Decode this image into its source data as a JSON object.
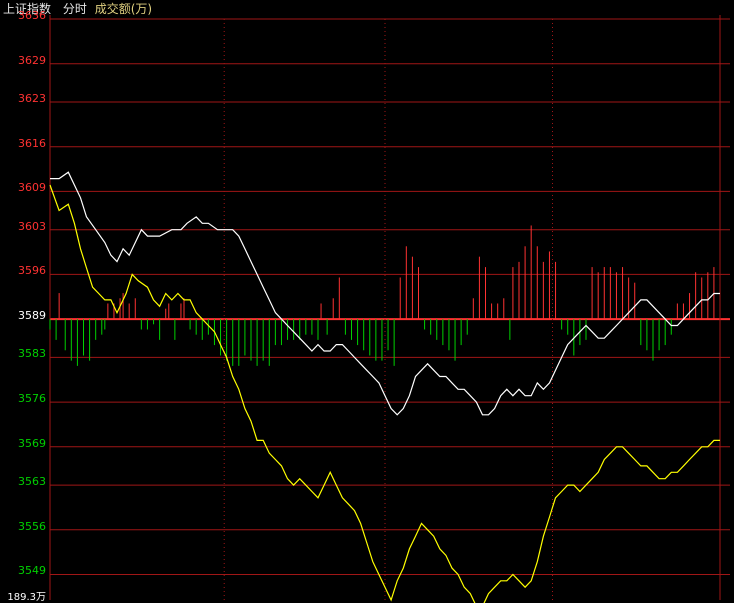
{
  "header": {
    "index_name": "上证指数",
    "mode": "分时",
    "volume_unit": "成交额(万)"
  },
  "colors": {
    "up": "#ff3232",
    "down": "#00d000",
    "baseline": "#ff3232",
    "grid": "#a01616",
    "price_line": "#ffffff",
    "avg_line": "#ffff00"
  },
  "chart_data": {
    "type": "line",
    "title": "",
    "baseline": 3589,
    "ylim": [
      3545,
      3636
    ],
    "y_ticks": [
      "3636",
      "3629",
      "3623",
      "3616",
      "3609",
      "3603",
      "3596",
      "3589",
      "3583",
      "3576",
      "3569",
      "3563",
      "3556",
      "3549"
    ],
    "volume_axis_label": "189.3万",
    "series": [
      {
        "kind": "price",
        "points": [
          [
            0,
            3611
          ],
          [
            3,
            3611
          ],
          [
            6,
            3612
          ],
          [
            8,
            3610
          ],
          [
            10,
            3608
          ],
          [
            12,
            3605
          ],
          [
            15,
            3603
          ],
          [
            18,
            3601
          ],
          [
            20,
            3599
          ],
          [
            22,
            3598
          ],
          [
            24,
            3600
          ],
          [
            26,
            3599
          ],
          [
            28,
            3601
          ],
          [
            30,
            3603
          ],
          [
            32,
            3602
          ],
          [
            36,
            3602
          ],
          [
            40,
            3603
          ],
          [
            43,
            3603
          ],
          [
            45,
            3604
          ],
          [
            48,
            3605
          ],
          [
            50,
            3604
          ],
          [
            52,
            3604
          ],
          [
            55,
            3603
          ],
          [
            58,
            3603
          ],
          [
            60,
            3603
          ],
          [
            62,
            3602
          ],
          [
            64,
            3600
          ],
          [
            66,
            3598
          ],
          [
            68,
            3596
          ],
          [
            70,
            3594
          ],
          [
            72,
            3592
          ],
          [
            74,
            3590
          ],
          [
            76,
            3589
          ],
          [
            78,
            3588
          ],
          [
            80,
            3587
          ],
          [
            82,
            3586
          ],
          [
            84,
            3585
          ],
          [
            86,
            3584
          ],
          [
            88,
            3585
          ],
          [
            90,
            3584
          ],
          [
            92,
            3584
          ],
          [
            94,
            3585
          ],
          [
            96,
            3585
          ],
          [
            98,
            3584
          ],
          [
            100,
            3583
          ],
          [
            102,
            3582
          ],
          [
            104,
            3581
          ],
          [
            106,
            3580
          ],
          [
            108,
            3579
          ],
          [
            110,
            3577
          ],
          [
            112,
            3575
          ],
          [
            114,
            3574
          ],
          [
            116,
            3575
          ],
          [
            118,
            3577
          ],
          [
            120,
            3580
          ],
          [
            122,
            3581
          ],
          [
            124,
            3582
          ],
          [
            126,
            3581
          ],
          [
            128,
            3580
          ],
          [
            130,
            3580
          ],
          [
            132,
            3579
          ],
          [
            134,
            3578
          ],
          [
            136,
            3578
          ],
          [
            138,
            3577
          ],
          [
            140,
            3576
          ],
          [
            142,
            3574
          ],
          [
            144,
            3574
          ],
          [
            146,
            3575
          ],
          [
            148,
            3577
          ],
          [
            150,
            3578
          ],
          [
            152,
            3577
          ],
          [
            154,
            3578
          ],
          [
            156,
            3577
          ],
          [
            158,
            3577
          ],
          [
            160,
            3579
          ],
          [
            162,
            3578
          ],
          [
            164,
            3579
          ],
          [
            166,
            3581
          ],
          [
            168,
            3583
          ],
          [
            170,
            3585
          ],
          [
            172,
            3586
          ],
          [
            174,
            3587
          ],
          [
            176,
            3588
          ],
          [
            178,
            3587
          ],
          [
            180,
            3586
          ],
          [
            182,
            3586
          ],
          [
            184,
            3587
          ],
          [
            186,
            3588
          ],
          [
            188,
            3589
          ],
          [
            190,
            3590
          ],
          [
            192,
            3591
          ],
          [
            194,
            3592
          ],
          [
            196,
            3592
          ],
          [
            198,
            3591
          ],
          [
            200,
            3590
          ],
          [
            202,
            3589
          ],
          [
            204,
            3588
          ],
          [
            206,
            3588
          ],
          [
            208,
            3589
          ],
          [
            210,
            3590
          ],
          [
            212,
            3591
          ],
          [
            214,
            3592
          ],
          [
            216,
            3592
          ],
          [
            218,
            3593
          ],
          [
            220,
            3593
          ]
        ]
      },
      {
        "kind": "average",
        "points": [
          [
            0,
            3610
          ],
          [
            3,
            3606
          ],
          [
            6,
            3607
          ],
          [
            8,
            3604
          ],
          [
            10,
            3600
          ],
          [
            12,
            3597
          ],
          [
            14,
            3594
          ],
          [
            16,
            3593
          ],
          [
            18,
            3592
          ],
          [
            20,
            3592
          ],
          [
            22,
            3590
          ],
          [
            25,
            3593
          ],
          [
            27,
            3596
          ],
          [
            29,
            3595
          ],
          [
            32,
            3594
          ],
          [
            34,
            3592
          ],
          [
            36,
            3591
          ],
          [
            38,
            3593
          ],
          [
            40,
            3592
          ],
          [
            42,
            3593
          ],
          [
            44,
            3592
          ],
          [
            46,
            3592
          ],
          [
            48,
            3590
          ],
          [
            50,
            3589
          ],
          [
            52,
            3588
          ],
          [
            54,
            3587
          ],
          [
            56,
            3585
          ],
          [
            58,
            3583
          ],
          [
            60,
            3580
          ],
          [
            62,
            3578
          ],
          [
            64,
            3575
          ],
          [
            66,
            3573
          ],
          [
            68,
            3570
          ],
          [
            70,
            3570
          ],
          [
            72,
            3568
          ],
          [
            74,
            3567
          ],
          [
            76,
            3566
          ],
          [
            78,
            3564
          ],
          [
            80,
            3563
          ],
          [
            82,
            3564
          ],
          [
            84,
            3563
          ],
          [
            86,
            3562
          ],
          [
            88,
            3561
          ],
          [
            90,
            3563
          ],
          [
            92,
            3565
          ],
          [
            94,
            3563
          ],
          [
            96,
            3561
          ],
          [
            98,
            3560
          ],
          [
            100,
            3559
          ],
          [
            102,
            3557
          ],
          [
            104,
            3554
          ],
          [
            106,
            3551
          ],
          [
            108,
            3549
          ],
          [
            110,
            3547
          ],
          [
            112,
            3545
          ],
          [
            114,
            3548
          ],
          [
            116,
            3550
          ],
          [
            118,
            3553
          ],
          [
            120,
            3555
          ],
          [
            122,
            3557
          ],
          [
            124,
            3556
          ],
          [
            126,
            3555
          ],
          [
            128,
            3553
          ],
          [
            130,
            3552
          ],
          [
            132,
            3550
          ],
          [
            134,
            3549
          ],
          [
            136,
            3547
          ],
          [
            138,
            3546
          ],
          [
            140,
            3544
          ],
          [
            142,
            3544
          ],
          [
            144,
            3546
          ],
          [
            146,
            3547
          ],
          [
            148,
            3548
          ],
          [
            150,
            3548
          ],
          [
            152,
            3549
          ],
          [
            154,
            3548
          ],
          [
            156,
            3547
          ],
          [
            158,
            3548
          ],
          [
            160,
            3551
          ],
          [
            162,
            3555
          ],
          [
            164,
            3558
          ],
          [
            166,
            3561
          ],
          [
            168,
            3562
          ],
          [
            170,
            3563
          ],
          [
            172,
            3563
          ],
          [
            174,
            3562
          ],
          [
            176,
            3563
          ],
          [
            178,
            3564
          ],
          [
            180,
            3565
          ],
          [
            182,
            3567
          ],
          [
            184,
            3568
          ],
          [
            186,
            3569
          ],
          [
            188,
            3569
          ],
          [
            190,
            3568
          ],
          [
            192,
            3567
          ],
          [
            194,
            3566
          ],
          [
            196,
            3566
          ],
          [
            198,
            3565
          ],
          [
            200,
            3564
          ],
          [
            202,
            3564
          ],
          [
            204,
            3565
          ],
          [
            206,
            3565
          ],
          [
            208,
            3566
          ],
          [
            210,
            3567
          ],
          [
            212,
            3568
          ],
          [
            214,
            3569
          ],
          [
            216,
            3569
          ],
          [
            218,
            3570
          ],
          [
            220,
            3570
          ]
        ]
      }
    ],
    "volume_bars": [
      [
        0,
        -2
      ],
      [
        2,
        -4
      ],
      [
        3,
        5
      ],
      [
        5,
        -6
      ],
      [
        7,
        -8
      ],
      [
        9,
        -9
      ],
      [
        11,
        -7
      ],
      [
        13,
        -8
      ],
      [
        15,
        -4
      ],
      [
        17,
        -3
      ],
      [
        18,
        -2
      ],
      [
        19,
        3
      ],
      [
        21,
        3
      ],
      [
        23,
        4
      ],
      [
        24,
        5
      ],
      [
        26,
        3
      ],
      [
        28,
        4
      ],
      [
        30,
        -2
      ],
      [
        32,
        -2
      ],
      [
        34,
        -1
      ],
      [
        36,
        -4
      ],
      [
        38,
        2
      ],
      [
        39,
        3
      ],
      [
        41,
        -4
      ],
      [
        43,
        3
      ],
      [
        44,
        4
      ],
      [
        46,
        -2
      ],
      [
        48,
        -3
      ],
      [
        50,
        -4
      ],
      [
        52,
        -3
      ],
      [
        54,
        -5
      ],
      [
        56,
        -7
      ],
      [
        58,
        -8
      ],
      [
        60,
        -9
      ],
      [
        62,
        -9
      ],
      [
        64,
        -7
      ],
      [
        66,
        -8
      ],
      [
        68,
        -9
      ],
      [
        70,
        -8
      ],
      [
        72,
        -9
      ],
      [
        74,
        -5
      ],
      [
        76,
        -5
      ],
      [
        78,
        -4
      ],
      [
        80,
        -4
      ],
      [
        82,
        -4
      ],
      [
        84,
        -3
      ],
      [
        86,
        -3
      ],
      [
        88,
        -4
      ],
      [
        89,
        3
      ],
      [
        91,
        -3
      ],
      [
        93,
        4
      ],
      [
        95,
        8
      ],
      [
        97,
        -3
      ],
      [
        99,
        -4
      ],
      [
        101,
        -5
      ],
      [
        103,
        -6
      ],
      [
        105,
        -7
      ],
      [
        107,
        -8
      ],
      [
        109,
        -8
      ],
      [
        111,
        -6
      ],
      [
        113,
        -9
      ],
      [
        115,
        8
      ],
      [
        117,
        14
      ],
      [
        119,
        12
      ],
      [
        121,
        10
      ],
      [
        123,
        -2
      ],
      [
        125,
        -3
      ],
      [
        127,
        -4
      ],
      [
        129,
        -5
      ],
      [
        131,
        -6
      ],
      [
        133,
        -8
      ],
      [
        135,
        -5
      ],
      [
        137,
        -3
      ],
      [
        139,
        4
      ],
      [
        141,
        12
      ],
      [
        143,
        10
      ],
      [
        145,
        3
      ],
      [
        147,
        3
      ],
      [
        149,
        4
      ],
      [
        151,
        -4
      ],
      [
        152,
        10
      ],
      [
        154,
        11
      ],
      [
        156,
        14
      ],
      [
        158,
        18
      ],
      [
        160,
        14
      ],
      [
        162,
        11
      ],
      [
        164,
        13
      ],
      [
        166,
        11
      ],
      [
        168,
        -2
      ],
      [
        170,
        -3
      ],
      [
        172,
        -7
      ],
      [
        174,
        -5
      ],
      [
        176,
        -4
      ],
      [
        178,
        10
      ],
      [
        180,
        9
      ],
      [
        182,
        10
      ],
      [
        184,
        10
      ],
      [
        186,
        9
      ],
      [
        188,
        10
      ],
      [
        190,
        8
      ],
      [
        192,
        7
      ],
      [
        194,
        -5
      ],
      [
        196,
        -6
      ],
      [
        198,
        -8
      ],
      [
        200,
        -6
      ],
      [
        202,
        -5
      ],
      [
        204,
        -3
      ],
      [
        206,
        3
      ],
      [
        208,
        3
      ],
      [
        210,
        5
      ],
      [
        212,
        9
      ],
      [
        214,
        8
      ],
      [
        216,
        9
      ],
      [
        218,
        10
      ]
    ]
  }
}
